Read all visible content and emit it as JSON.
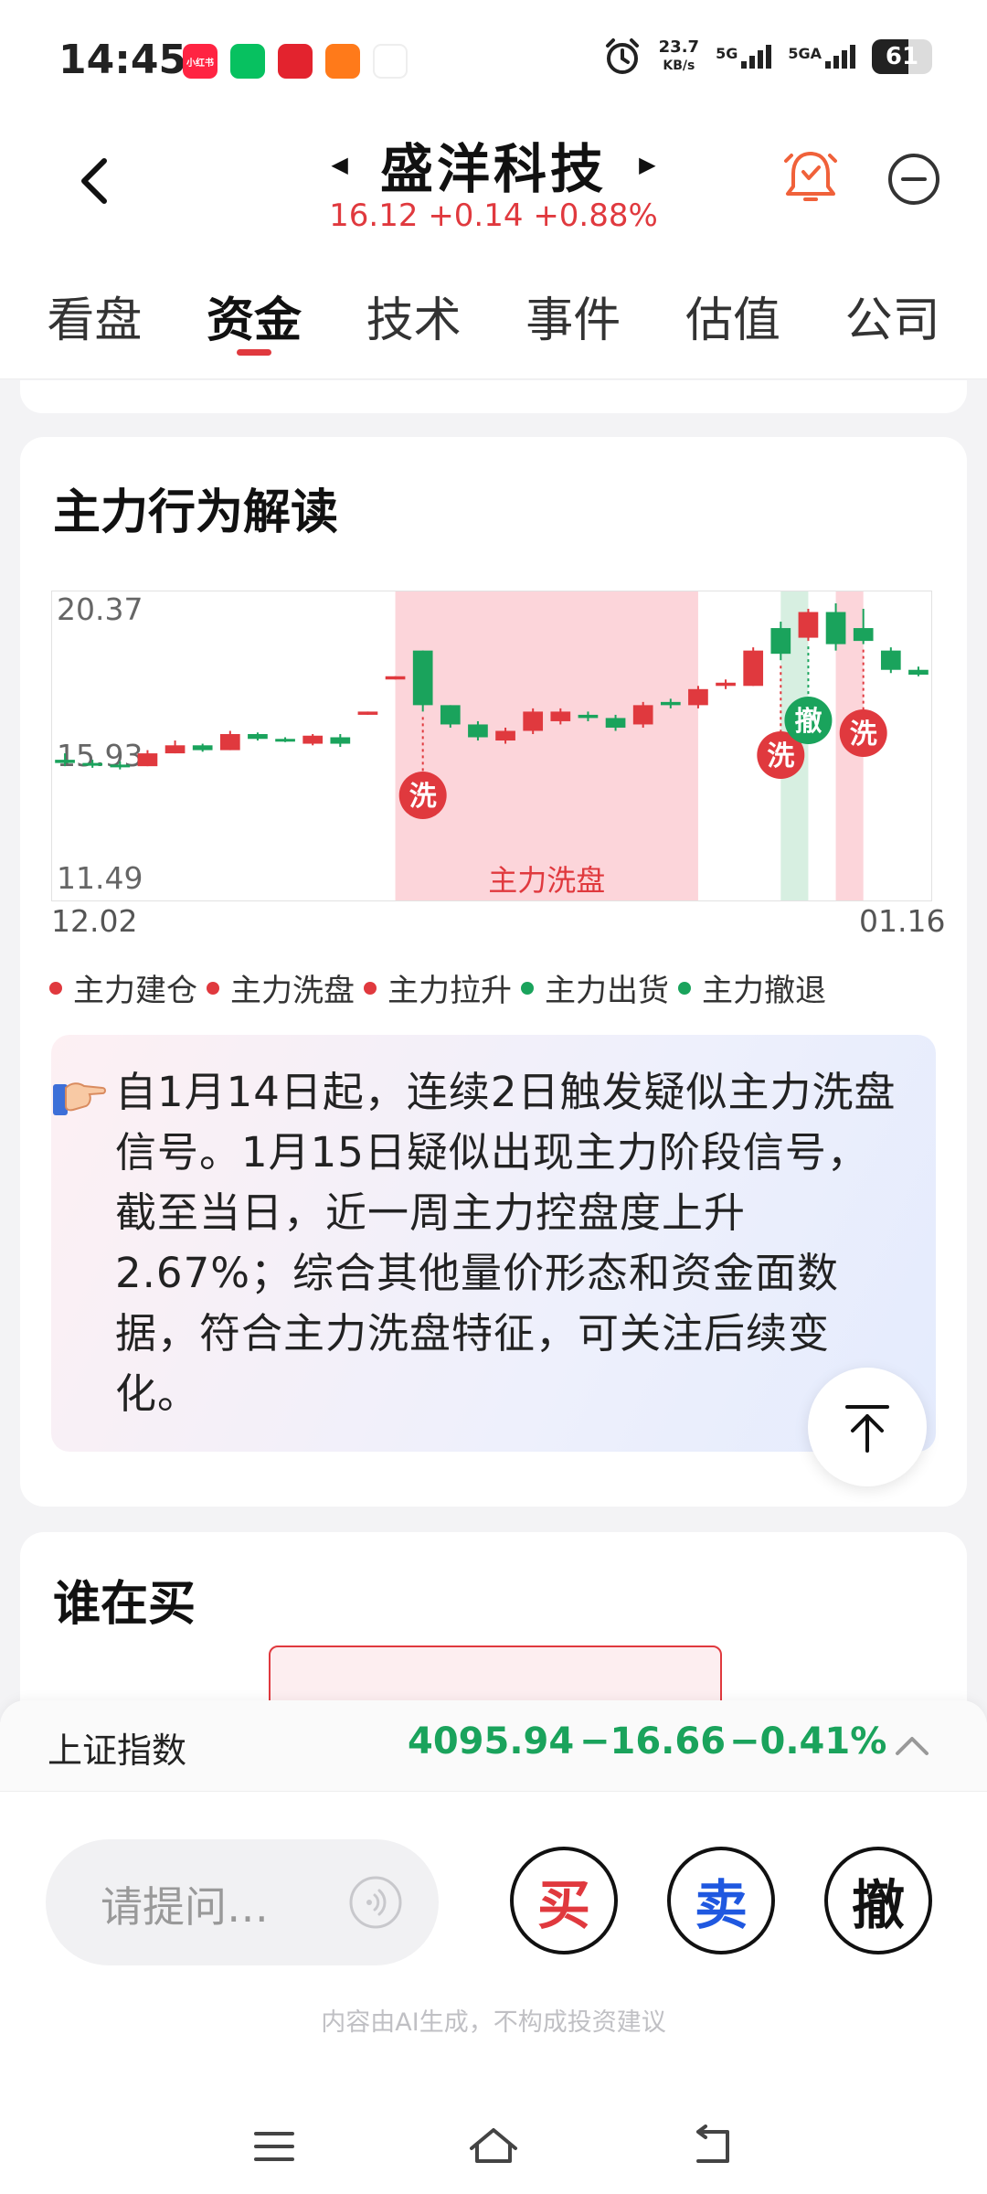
{
  "status_bar": {
    "time": "14:45",
    "apps": [
      {
        "name": "xiaohongshu-app-icon",
        "text": "小红书",
        "color": "#ff2442"
      },
      {
        "name": "wechat-app-icon",
        "text": "",
        "color": "#07c160"
      },
      {
        "name": "heart-app-icon",
        "text": "",
        "color": "#e3232e"
      },
      {
        "name": "taobao-app-icon",
        "text": "",
        "color": "#ff7a1a"
      },
      {
        "name": "weibo-app-icon",
        "text": "",
        "color": "#ffffff"
      }
    ],
    "net_speed_value": "23.7",
    "net_speed_unit": "KB/s",
    "sig1_label": "5G",
    "sig2_label": "5GA",
    "battery": "61",
    "battery_level": 0.61
  },
  "header": {
    "stock_name": "盛洋科技",
    "quote": "16.12 +0.14 +0.88%"
  },
  "tabs": [
    {
      "label": "看盘",
      "active": false
    },
    {
      "label": "资金",
      "active": true
    },
    {
      "label": "技术",
      "active": false
    },
    {
      "label": "事件",
      "active": false
    },
    {
      "label": "估值",
      "active": false
    },
    {
      "label": "公司",
      "active": false
    }
  ],
  "main_card": {
    "title": "主力行为解读",
    "legend": [
      {
        "label": "主力建仓",
        "color": "#e0393e"
      },
      {
        "label": "主力洗盘",
        "color": "#e0393e"
      },
      {
        "label": "主力拉升",
        "color": "#e0393e"
      },
      {
        "label": "主力出货",
        "color": "#1aa35c"
      },
      {
        "label": "主力撤退",
        "color": "#1aa35c"
      }
    ],
    "ai_text": "自1月14日起，连续2日触发疑似主力洗盘信号。1月15日疑似出现主力阶段信号，截至当日，近一周主力控盘度上升2.67%；综合其他量价形态和资金面数据，符合主力洗盘特征，可关注后续变化。"
  },
  "chart_data": {
    "type": "candlestick",
    "x_start_label": "12.02",
    "x_end_label": "01.16",
    "y_tick_labels": [
      "20.37",
      "15.93",
      "11.49"
    ],
    "ylim": [
      11.49,
      20.37
    ],
    "up_color": "#e0393e",
    "down_color": "#1aa35c",
    "candles": [
      {
        "o": 15.5,
        "c": 15.4,
        "h": 15.7,
        "l": 15.3
      },
      {
        "o": 15.4,
        "c": 15.35,
        "h": 15.5,
        "l": 15.25
      },
      {
        "o": 15.35,
        "c": 15.3,
        "h": 15.45,
        "l": 15.2
      },
      {
        "o": 15.3,
        "c": 15.7,
        "h": 15.8,
        "l": 15.3
      },
      {
        "o": 15.7,
        "c": 15.95,
        "h": 16.1,
        "l": 15.7
      },
      {
        "o": 15.95,
        "c": 15.8,
        "h": 16.0,
        "l": 15.75
      },
      {
        "o": 15.8,
        "c": 16.3,
        "h": 16.4,
        "l": 15.8
      },
      {
        "o": 16.3,
        "c": 16.15,
        "h": 16.35,
        "l": 16.1
      },
      {
        "o": 16.15,
        "c": 16.1,
        "h": 16.2,
        "l": 16.05
      },
      {
        "o": 16.0,
        "c": 16.25,
        "h": 16.3,
        "l": 15.95
      },
      {
        "o": 16.2,
        "c": 16.0,
        "h": 16.3,
        "l": 15.9
      },
      {
        "o": 16.9,
        "c": 17.0,
        "h": 17.0,
        "l": 16.9
      },
      {
        "o": 18.0,
        "c": 18.1,
        "h": 18.1,
        "l": 18.0
      },
      {
        "o": 18.9,
        "c": 17.2,
        "h": 18.9,
        "l": 17.0
      },
      {
        "o": 17.2,
        "c": 16.6,
        "h": 17.2,
        "l": 16.5
      },
      {
        "o": 16.6,
        "c": 16.2,
        "h": 16.7,
        "l": 16.1
      },
      {
        "o": 16.1,
        "c": 16.4,
        "h": 16.5,
        "l": 16.0
      },
      {
        "o": 16.4,
        "c": 17.0,
        "h": 17.1,
        "l": 16.3
      },
      {
        "o": 16.7,
        "c": 17.0,
        "h": 17.1,
        "l": 16.6
      },
      {
        "o": 16.9,
        "c": 16.8,
        "h": 17.0,
        "l": 16.7
      },
      {
        "o": 16.8,
        "c": 16.5,
        "h": 16.9,
        "l": 16.4
      },
      {
        "o": 16.6,
        "c": 17.2,
        "h": 17.3,
        "l": 16.5
      },
      {
        "o": 17.3,
        "c": 17.2,
        "h": 17.4,
        "l": 17.1
      },
      {
        "o": 17.2,
        "c": 17.7,
        "h": 17.8,
        "l": 17.1
      },
      {
        "o": 17.8,
        "c": 17.9,
        "h": 18.0,
        "l": 17.7
      },
      {
        "o": 17.8,
        "c": 18.9,
        "h": 19.0,
        "l": 17.8
      },
      {
        "o": 19.6,
        "c": 18.8,
        "h": 19.8,
        "l": 18.6
      },
      {
        "o": 19.3,
        "c": 20.1,
        "h": 20.2,
        "l": 19.2
      },
      {
        "o": 20.1,
        "c": 19.1,
        "h": 20.37,
        "l": 18.9
      },
      {
        "o": 19.6,
        "c": 19.2,
        "h": 20.2,
        "l": 19.1
      },
      {
        "o": 18.9,
        "c": 18.3,
        "h": 19.0,
        "l": 18.2
      },
      {
        "o": 18.3,
        "c": 18.15,
        "h": 18.4,
        "l": 18.1
      }
    ],
    "shaded_regions": [
      {
        "from": 12.5,
        "to": 23.5,
        "color": "#fcd5da",
        "label": "主力洗盘"
      },
      {
        "from": 26.5,
        "to": 27.5,
        "color": "#d7efe1",
        "label": ""
      },
      {
        "from": 28.5,
        "to": 29.5,
        "color": "#fcd5da",
        "label": ""
      }
    ],
    "signals": [
      {
        "index": 13,
        "label": "洗",
        "color": "#e0393e"
      },
      {
        "index": 26,
        "label": "洗",
        "color": "#e0393e"
      },
      {
        "index": 27,
        "label": "撤",
        "color": "#1aa35c"
      },
      {
        "index": 29,
        "label": "洗",
        "color": "#e0393e"
      }
    ]
  },
  "card2": {
    "title": "谁在买"
  },
  "index_bar": {
    "name": "上证指数",
    "value": "4095.94",
    "change": "−16.66",
    "pct": "−0.41%"
  },
  "ask": {
    "placeholder": "请提问…"
  },
  "trade": {
    "buy": "买",
    "sell": "卖",
    "cancel": "撤"
  },
  "disclaimer": "内容由AI生成，不构成投资建议"
}
